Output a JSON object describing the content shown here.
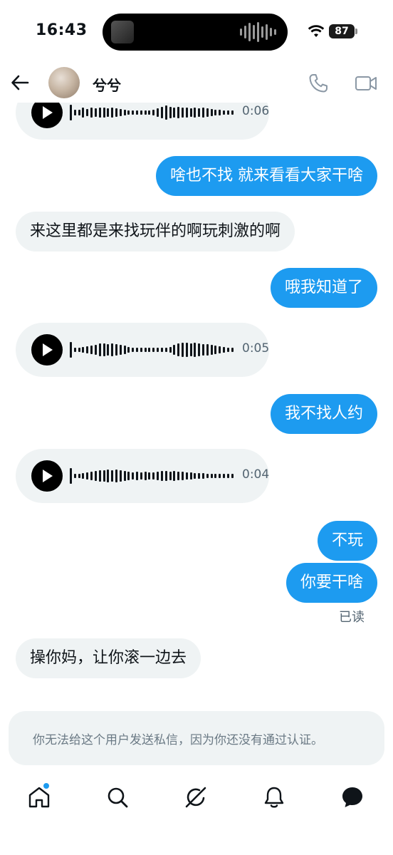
{
  "status_bar": {
    "time": "16:43",
    "battery": "87"
  },
  "header": {
    "contact_name": "兮兮"
  },
  "messages": [
    {
      "type": "voice",
      "dir": "in",
      "duration": "0:06"
    },
    {
      "type": "text",
      "dir": "out",
      "text": "啥也不找 就来看看大家干啥"
    },
    {
      "type": "text",
      "dir": "in",
      "text": "来这里都是来找玩伴的啊玩刺激的啊"
    },
    {
      "type": "text",
      "dir": "out",
      "text": "哦我知道了"
    },
    {
      "type": "voice",
      "dir": "in",
      "duration": "0:05"
    },
    {
      "type": "text",
      "dir": "out",
      "text": "我不找人约"
    },
    {
      "type": "voice",
      "dir": "in",
      "duration": "0:04"
    },
    {
      "type": "text",
      "dir": "out",
      "text": "不玩"
    },
    {
      "type": "text",
      "dir": "out",
      "text": "你要干啥"
    },
    {
      "type": "text",
      "dir": "in",
      "text": "操你妈，让你滚一边去"
    }
  ],
  "read_receipt": "已读",
  "notice": "你无法给这个用户发送私信，因为你还没有通过认证。",
  "nav": {
    "items": [
      "home-icon",
      "search-icon",
      "grok-icon",
      "bell-icon",
      "messages-icon"
    ],
    "home_has_badge": true
  },
  "colors": {
    "accent": "#1d9bf0",
    "incoming_bubble": "#eff3f4",
    "text": "#0f1419",
    "muted": "#536471"
  }
}
